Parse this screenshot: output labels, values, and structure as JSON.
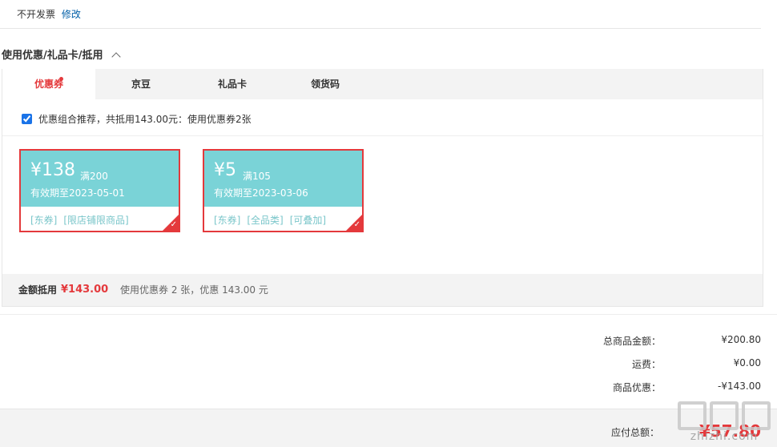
{
  "invoice": {
    "text": "不开发票",
    "edit_link": "修改"
  },
  "section": {
    "title": "使用优惠/礼品卡/抵用"
  },
  "tabs": [
    {
      "label": "优惠券",
      "active": true,
      "has_dot": true
    },
    {
      "label": "京豆",
      "active": false
    },
    {
      "label": "礼品卡",
      "active": false
    },
    {
      "label": "领货码",
      "active": false
    }
  ],
  "recommend": {
    "checked": true,
    "text": "优惠组合推荐，共抵用143.00元：使用优惠券2张"
  },
  "coupons": [
    {
      "amount": "¥138",
      "condition": "满200",
      "validity": "有效期至2023-05-01",
      "tags": [
        "[东券]",
        "[限店铺限商品]"
      ],
      "selected": true
    },
    {
      "amount": "¥5",
      "condition": "满105",
      "validity": "有效期至2023-03-06",
      "tags": [
        "[东券]",
        "[全品类]",
        "[可叠加]"
      ],
      "selected": true
    }
  ],
  "summary": {
    "label": "金额抵用",
    "amount": "¥143.00",
    "desc": "使用优惠券 2 张，优惠 143.00 元"
  },
  "totals": [
    {
      "label": "总商品金额：",
      "value": "¥200.80"
    },
    {
      "label": "运费：",
      "value": "¥0.00"
    },
    {
      "label": "商品优惠：",
      "value": "-¥143.00"
    }
  ],
  "payable": {
    "label": "应付总额：",
    "value": "¥57.80"
  },
  "watermark": {
    "text": "zhizhi.com"
  },
  "colors": {
    "accent": "#e4393c",
    "coupon_bg": "#7ad3d7",
    "link": "#005ea7",
    "tag": "#7ac6ca"
  }
}
